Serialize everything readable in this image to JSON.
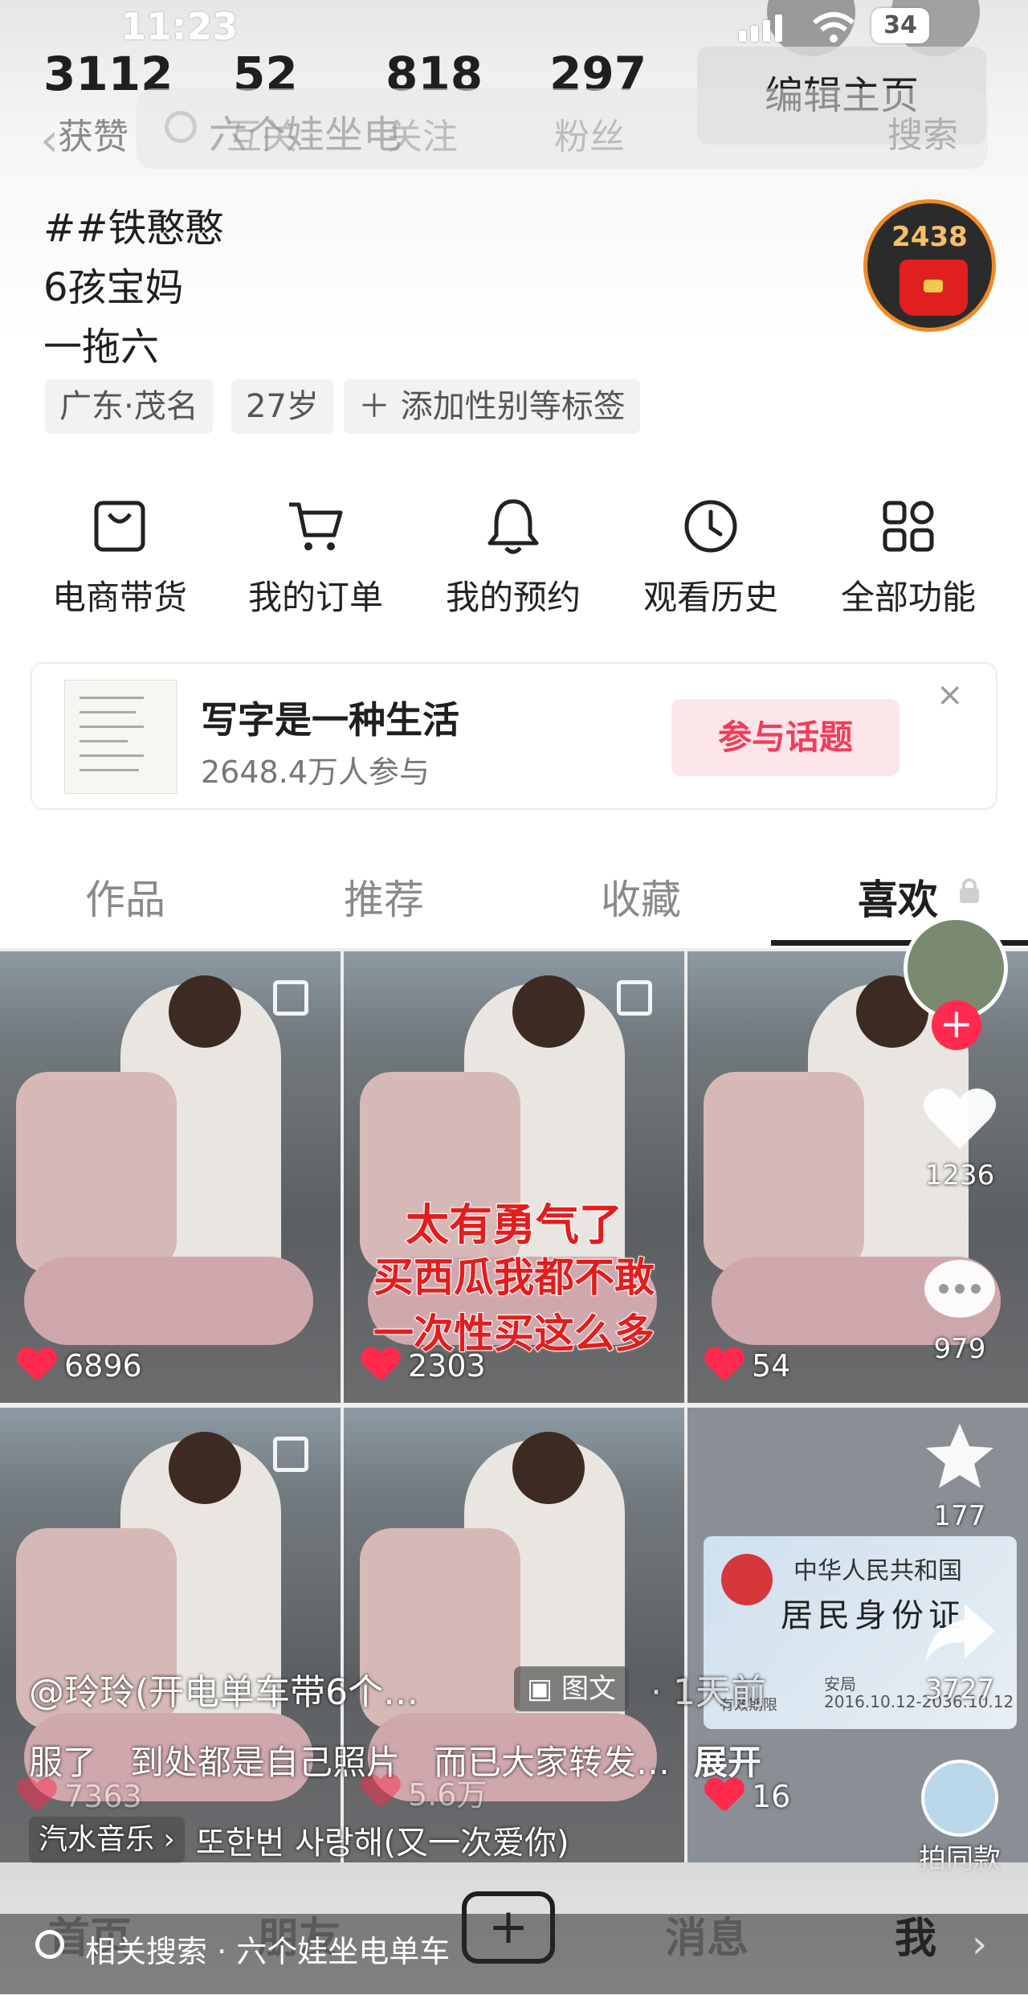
{
  "status": {
    "time": "11:23",
    "battery": "34"
  },
  "stats": [
    {
      "num": "3112",
      "label": "获赞"
    },
    {
      "num": "52",
      "label": "互关"
    },
    {
      "num": "818",
      "label": "关注"
    },
    {
      "num": "297",
      "label": "粉丝"
    }
  ],
  "edit_profile": "编辑主页",
  "search": {
    "placeholder": "六个娃坐电",
    "button": "搜索"
  },
  "bio": {
    "name_line": "##铁憨憨",
    "line2": "6孩宝妈",
    "line3": "一拖六"
  },
  "red_packet_count": "2438",
  "tags": [
    "广东·茂名",
    "27岁",
    "＋ 添加性别等标签"
  ],
  "functions": [
    {
      "label": "电商带货",
      "icon": "shopping-bag-icon"
    },
    {
      "label": "我的订单",
      "icon": "cart-icon"
    },
    {
      "label": "我的预约",
      "icon": "bell-icon"
    },
    {
      "label": "观看历史",
      "icon": "clock-icon"
    },
    {
      "label": "全部功能",
      "icon": "grid-icon"
    }
  ],
  "topic": {
    "title": "写字是一种生活",
    "sub": "2648.4万人参与",
    "button": "参与话题",
    "close": "×"
  },
  "tabs": [
    "作品",
    "推荐",
    "收藏",
    "喜欢"
  ],
  "grid": [
    {
      "likes": "6896",
      "overlay": ""
    },
    {
      "likes": "2303",
      "overlay_lines": [
        "太有勇气了",
        "买西瓜我都不敢",
        "一次性买这么多"
      ]
    },
    {
      "likes": "54"
    },
    {
      "likes": "7363"
    },
    {
      "likes": "5.6万"
    },
    {
      "likes": "16"
    }
  ],
  "id_card": {
    "line1": "中华人民共和国",
    "line2": "居民身份证",
    "authority": "安局",
    "validity_label": "有效期限",
    "validity": "2016.10.12-2036.10.12"
  },
  "right_actions": {
    "likes": "1236",
    "comments": "979",
    "favorites": "177",
    "shares": "3727",
    "same_style": "拍同款"
  },
  "caption": {
    "author": "@玲玲(开电单车带6个…",
    "badge": "图文",
    "time": "· 1天前",
    "text": "服了　到处都是自己照片　而已大家转发…",
    "more": "展开"
  },
  "music": {
    "source": "汽水音乐 ›",
    "song": "또한번 사랑해(又一次爱你)"
  },
  "nav": [
    "首页",
    "朋友",
    "+",
    "消息",
    "我"
  ],
  "related": {
    "text": "相关搜索 · 六个娃坐电单车",
    "arrow": "›"
  },
  "colors": {
    "accent_red": "#f23d5c",
    "heart": "#ff2b4e",
    "badge_orange": "#f08a24"
  }
}
